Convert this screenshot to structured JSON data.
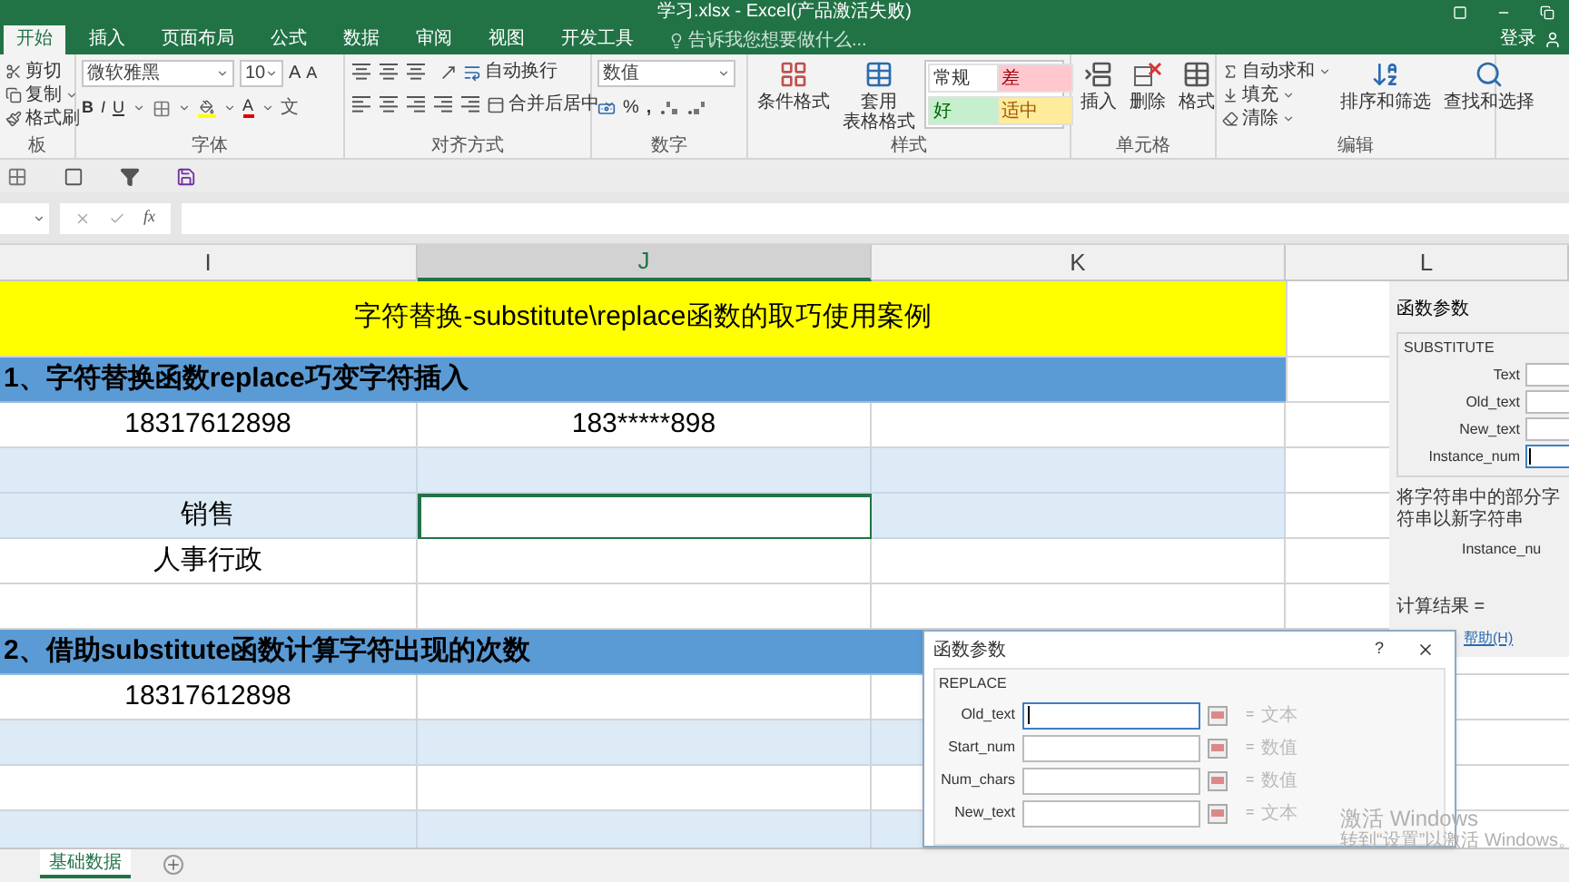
{
  "window": {
    "title": "学习.xlsx - Excel(产品激活失败)",
    "sign_in": "登录"
  },
  "tabs": [
    {
      "label": "开始",
      "selected": true
    },
    {
      "label": "插入",
      "selected": false
    },
    {
      "label": "页面布局",
      "selected": false
    },
    {
      "label": "公式",
      "selected": false
    },
    {
      "label": "数据",
      "selected": false
    },
    {
      "label": "审阅",
      "selected": false
    },
    {
      "label": "视图",
      "selected": false
    },
    {
      "label": "开发工具",
      "selected": false
    }
  ],
  "tell_me": {
    "placeholder": "告诉我您想要做什么..."
  },
  "ribbon": [
    {
      "kind": "clipboard",
      "label": "板",
      "items": [
        "剪切",
        "复制",
        "格式刷"
      ]
    },
    {
      "kind": "font",
      "label": "字体",
      "font": "微软雅黑",
      "size": "10",
      "grow": "A",
      "shrink": "A",
      "bold": "B",
      "italic": "I",
      "underline": "U",
      "font_color": "A",
      "phonetic": "文"
    },
    {
      "kind": "align",
      "label": "对齐方式",
      "wrap": "自动换行",
      "merge": "合并后居中"
    },
    {
      "kind": "number",
      "label": "数字",
      "format": "数值",
      "percent": "%",
      "comma": ","
    },
    {
      "kind": "styles",
      "label": "样式",
      "buttons": [
        [
          "条件格式"
        ],
        [
          "套用",
          "表格格式"
        ]
      ],
      "gallery": [
        {
          "text": "常规",
          "color": "#ffffff"
        },
        {
          "text": "差",
          "color": "#ffc7ce"
        },
        {
          "text": "好",
          "color": "#c6efce"
        },
        {
          "text": "适中",
          "color": "#ffeb9c"
        }
      ]
    },
    {
      "kind": "cells",
      "label": "单元格",
      "buttons": [
        "插入",
        "删除",
        "格式"
      ]
    },
    {
      "kind": "editing",
      "label": "编辑",
      "small": [
        "自动求和",
        "填充",
        "清除"
      ],
      "buttons": [
        "排序和筛选",
        "查找和选择"
      ]
    }
  ],
  "formula_bar": {
    "fx": "fx"
  },
  "columns": [
    {
      "label": "I",
      "selected": false
    },
    {
      "label": "J",
      "selected": true
    },
    {
      "label": "K",
      "selected": false
    },
    {
      "label": "L",
      "selected": false
    }
  ],
  "rows": [
    {
      "kind": "title",
      "text": "字符替换-substitute\\replace函数的取巧使用案例"
    },
    {
      "kind": "section",
      "text": "1、字符替换函数replace巧变字符插入"
    },
    {
      "kind": "data",
      "band": false,
      "cells": [
        "18317612898",
        "183*****898"
      ]
    },
    {
      "kind": "data",
      "band": true
    },
    {
      "kind": "data",
      "band": true,
      "active": true,
      "cells": [
        "销售"
      ]
    },
    {
      "kind": "data",
      "band": false,
      "cells": [
        "人事行政"
      ]
    },
    {
      "kind": "data",
      "band": false
    },
    {
      "kind": "section",
      "text": "2、借助substitute函数计算字符出现的次数"
    },
    {
      "kind": "data",
      "band": false,
      "cells": [
        "18317612898"
      ]
    },
    {
      "kind": "data",
      "band": true
    },
    {
      "kind": "data",
      "band": false
    },
    {
      "kind": "data",
      "band": true
    }
  ],
  "sheet_tabs": [
    {
      "label": "基础数据",
      "selected": true
    }
  ],
  "substitute_panel": {
    "title": "函数参数",
    "function": "SUBSTITUTE",
    "args": [
      {
        "name": "Text",
        "focused": false
      },
      {
        "name": "Old_text",
        "focused": false
      },
      {
        "name": "New_text",
        "focused": false
      },
      {
        "name": "Instance_num",
        "focused": true
      }
    ],
    "description": "将字符串中的部分字符串以新字符串",
    "arg_help": "Instance_nu",
    "result_label": "计算结果 =",
    "help_link": "帮助(H)"
  },
  "replace_dialog": {
    "title": "函数参数",
    "help": "?",
    "function": "REPLACE",
    "args": [
      {
        "name": "Old_text",
        "focused": true,
        "equals": "=",
        "result": "文本"
      },
      {
        "name": "Start_num",
        "focused": false,
        "equals": "=",
        "result": "数值"
      },
      {
        "name": "Num_chars",
        "focused": false,
        "equals": "=",
        "result": "数值"
      },
      {
        "name": "New_text",
        "focused": false,
        "equals": "=",
        "result": "文本"
      }
    ]
  },
  "activation": {
    "title": "激活 Windows",
    "hint": "转到“设置”以激活 Windows。"
  }
}
